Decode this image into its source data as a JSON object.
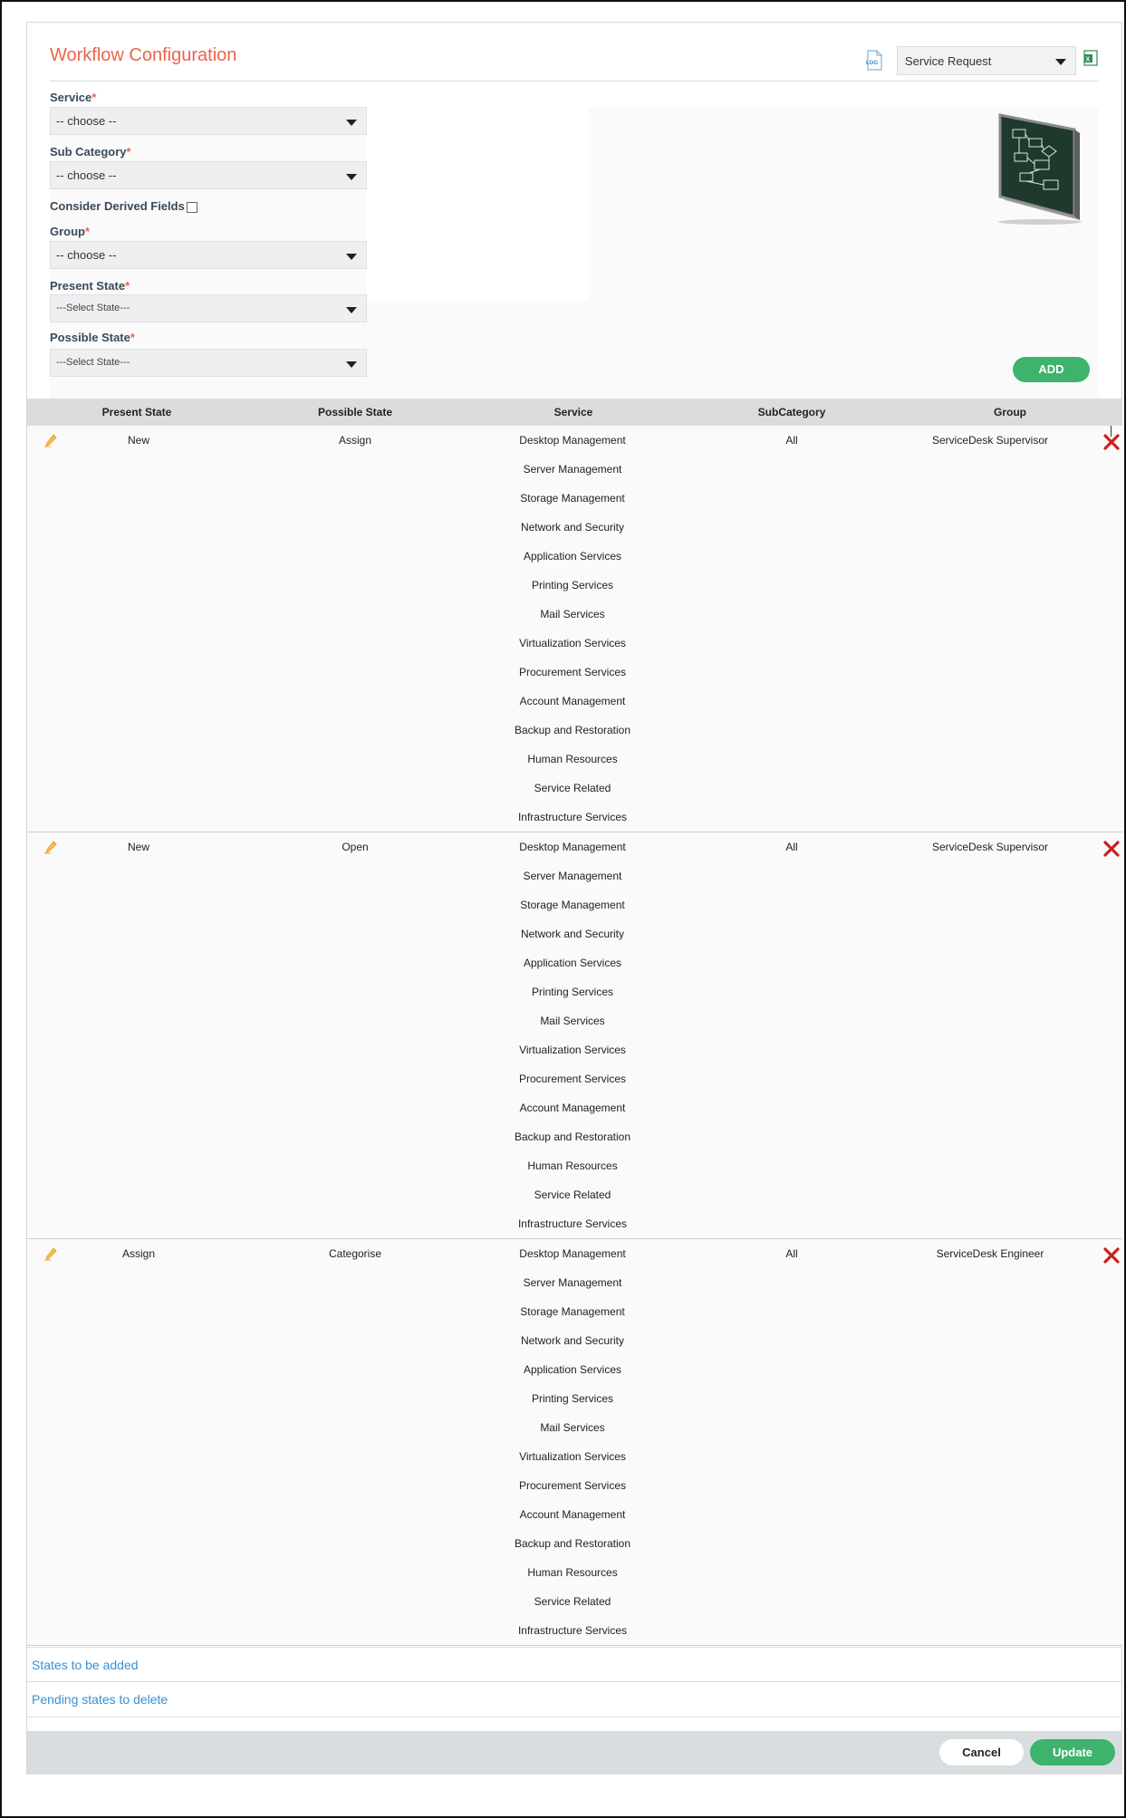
{
  "header": {
    "title": "Workflow Configuration",
    "type_select_value": "Service Request",
    "log_icon": "log-icon",
    "export_icon": "excel-export-icon"
  },
  "form": {
    "service_label": "Service",
    "service_value": "-- choose --",
    "subcategory_label": "Sub Category",
    "subcategory_value": "-- choose --",
    "derived_label": "Consider Derived Fields",
    "derived_checked": false,
    "group_label": "Group",
    "group_value": "-- choose --",
    "present_state_label": "Present State",
    "present_state_value": "---Select State---",
    "possible_state_label": "Possible State",
    "possible_state_value": "---Select State---",
    "required_mark": "*",
    "add_label": "ADD"
  },
  "table": {
    "columns": [
      "Present State",
      "Possible State",
      "Service",
      "SubCategory",
      "Group"
    ],
    "rows": [
      {
        "present": "New",
        "possible": "Assign",
        "subcategory": "All",
        "group": "ServiceDesk Supervisor",
        "services": [
          "Desktop Management",
          "Server Management",
          "Storage Management",
          "Network and Security",
          "Application Services",
          "Printing Services",
          "Mail Services",
          "Virtualization Services",
          "Procurement Services",
          "Account Management",
          "Backup and Restoration",
          "Human Resources",
          "Service Related",
          "Infrastructure Services"
        ]
      },
      {
        "present": "New",
        "possible": "Open",
        "subcategory": "All",
        "group": "ServiceDesk Supervisor",
        "services": [
          "Desktop Management",
          "Server Management",
          "Storage Management",
          "Network and Security",
          "Application Services",
          "Printing Services",
          "Mail Services",
          "Virtualization Services",
          "Procurement Services",
          "Account Management",
          "Backup and Restoration",
          "Human Resources",
          "Service Related",
          "Infrastructure Services"
        ]
      },
      {
        "present": "Assign",
        "possible": "Categorise",
        "subcategory": "All",
        "group": "ServiceDesk Engineer",
        "services": [
          "Desktop Management",
          "Server Management",
          "Storage Management",
          "Network and Security",
          "Application Services",
          "Printing Services",
          "Mail Services",
          "Virtualization Services",
          "Procurement Services",
          "Account Management",
          "Backup and Restoration",
          "Human Resources",
          "Service Related",
          "Infrastructure Services"
        ]
      }
    ]
  },
  "links": {
    "states_to_add": "States to be added",
    "pending_delete": "Pending states to delete"
  },
  "footer": {
    "cancel_label": "Cancel",
    "update_label": "Update"
  },
  "colors": {
    "title": "#e9654c",
    "accent_green": "#3db36b",
    "link": "#3a8fd0",
    "delete_red": "#cc1f1f",
    "edit_orange": "#e8a23a"
  }
}
